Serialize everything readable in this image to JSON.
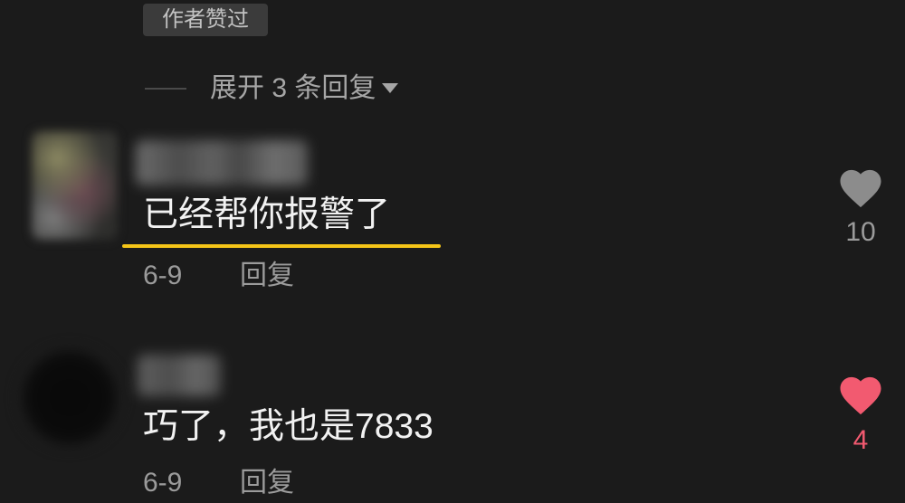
{
  "badge": {
    "label": "作者赞过"
  },
  "expand_replies": {
    "label": "展开 3 条回复",
    "icon": "triangle-down-icon"
  },
  "colors": {
    "background": "#1b1b1b",
    "secondary_text": "#9b9b9b",
    "highlight_underline": "#f5c518",
    "liked": "#f25a70",
    "unliked": "#8c8c8c"
  },
  "comments": [
    {
      "text": "已经帮你报警了",
      "date": "6-9",
      "reply_label": "回复",
      "like_count": "10",
      "liked": false,
      "like_icon": "heart-icon",
      "highlighted": true
    },
    {
      "text": "巧了，我也是7833",
      "date": "6-9",
      "reply_label": "回复",
      "like_count": "4",
      "liked": true,
      "like_icon": "heart-icon",
      "highlighted": false
    }
  ]
}
